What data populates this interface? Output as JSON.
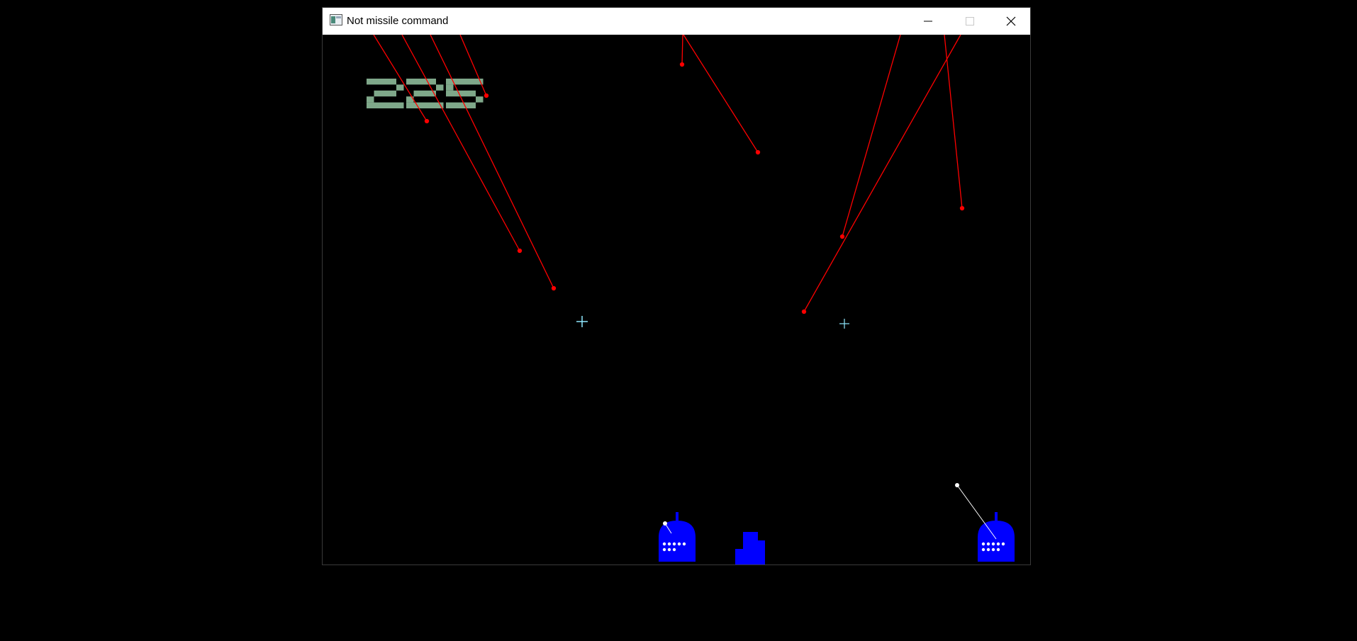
{
  "window": {
    "title": "Not missile command",
    "controls": [
      "minimize",
      "maximize",
      "close"
    ]
  },
  "game": {
    "score": "225",
    "colors": {
      "background": "#000000",
      "score": "#7fa88a",
      "enemy_missile": "#ff0000",
      "crosshair": "#8fe8ff",
      "base": "#0000ff",
      "ammo": "#ffffff"
    },
    "enemy_missile_count": 9,
    "crosshair_count": 2,
    "launchers": [
      {
        "name": "left-launcher",
        "ammo_remaining": 8
      },
      {
        "name": "right-launcher",
        "ammo_remaining": 9
      }
    ],
    "cities": 1
  }
}
